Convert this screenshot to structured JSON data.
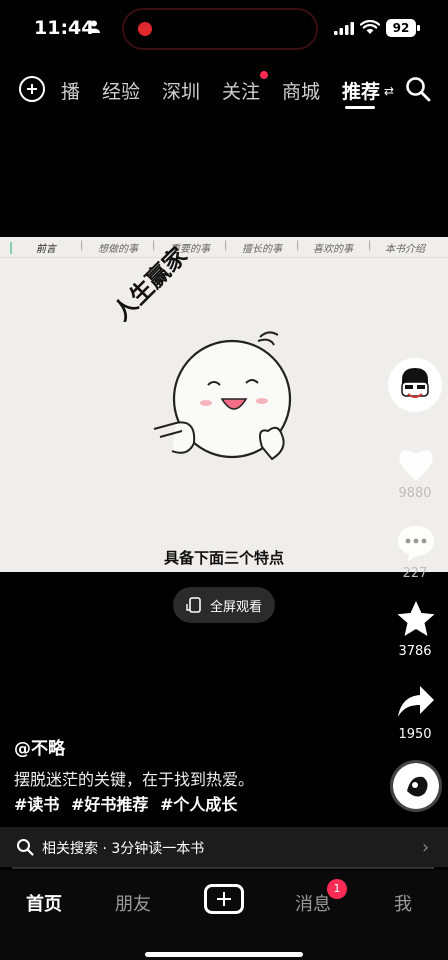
{
  "status_bar": {
    "time": "11:44",
    "battery": "92"
  },
  "top_nav": {
    "tabs": [
      {
        "label": "播"
      },
      {
        "label": "经验"
      },
      {
        "label": "深圳"
      },
      {
        "label": "关注"
      },
      {
        "label": "商城"
      },
      {
        "label": "推荐"
      }
    ],
    "active_tab": "推荐"
  },
  "video": {
    "chapters": [
      {
        "label": "前言"
      },
      {
        "label": "想做的事"
      },
      {
        "label": "重要的事"
      },
      {
        "label": "擅长的事"
      },
      {
        "label": "喜欢的事"
      },
      {
        "label": "本书介绍"
      }
    ],
    "sticker_text": "人生赢家",
    "caption": "具备下面三个特点",
    "fullscreen_label": "全屏观看"
  },
  "rail": {
    "likes": "9880",
    "comments": "227",
    "favorites": "3786",
    "shares": "1950"
  },
  "post": {
    "username": "@不略",
    "description": "摆脱迷茫的关键，在于找到热爱。",
    "tags": [
      "#读书",
      "#好书推荐",
      "#个人成长"
    ]
  },
  "related_search": {
    "label": "相关搜索",
    "separator": "·",
    "query": "3分钟读一本书"
  },
  "tab_bar": {
    "home": "首页",
    "friends": "朋友",
    "messages": "消息",
    "messages_badge": "1",
    "me": "我"
  },
  "colors": {
    "accent_red": "#fe2c55",
    "chapter_active": "#7bd3a7"
  }
}
